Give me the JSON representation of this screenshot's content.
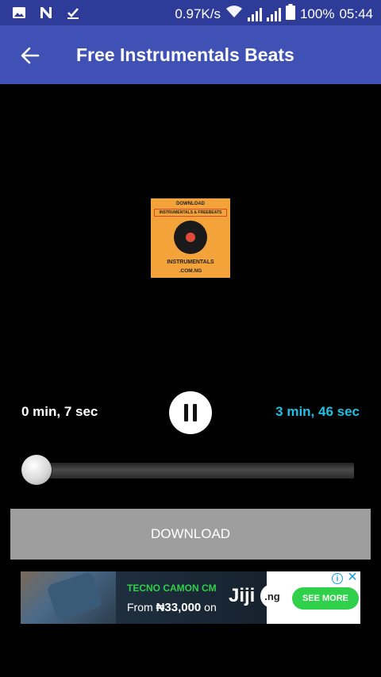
{
  "status_bar": {
    "net_speed": "0.97K/s",
    "battery": "100%",
    "time": "05:44",
    "icons": [
      "image-icon",
      "n-icon",
      "download-done-icon",
      "wifi-icon",
      "signal-icon",
      "battery-icon"
    ]
  },
  "app_bar": {
    "title": "Free Instrumentals Beats",
    "back_icon": "arrow-back-icon",
    "color": "#3f51b5"
  },
  "artwork": {
    "line1": "DOWNLOAD",
    "banner": "INSTRUMENTALS & FREEBEATS",
    "line2": "INSTRUMENTALS",
    "line3": ".COM.NG"
  },
  "player": {
    "elapsed": "0 min, 7 sec",
    "total": "3 min, 46 sec",
    "total_color": "#1ec0e3",
    "state": "playing",
    "progress_fraction": 0.031
  },
  "download": {
    "label": "DOWNLOAD"
  },
  "ad": {
    "headline": "TECNO CAMON CM",
    "price_prefix": "From",
    "price": "₦33,000",
    "price_suffix": "on",
    "brand": "Jiji",
    "brand_tld": ".ng",
    "cta": "SEE MORE",
    "info": "i",
    "close": "✕"
  }
}
